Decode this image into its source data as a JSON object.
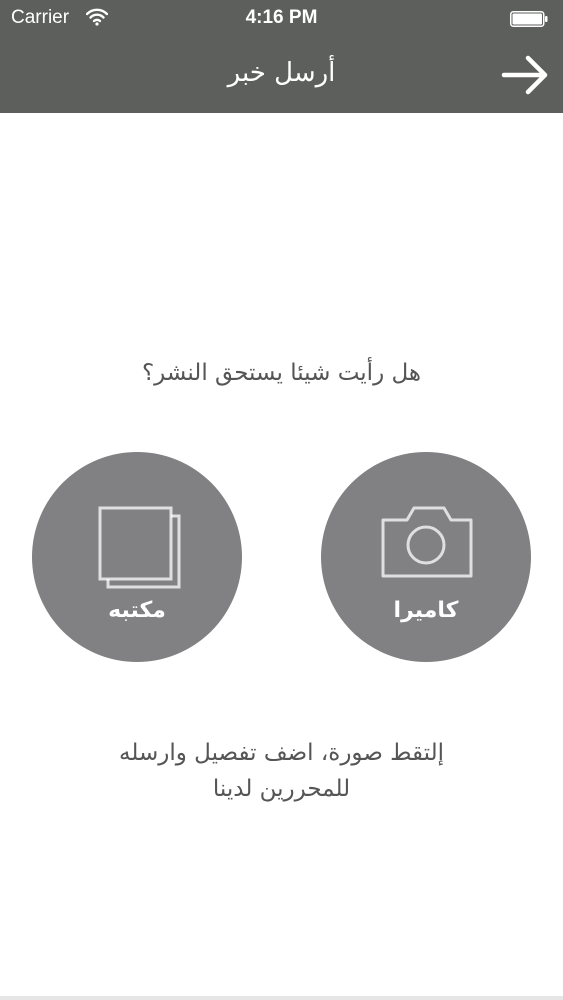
{
  "status_bar": {
    "carrier": "Carrier",
    "time": "4:16 PM",
    "wifi_icon": "wifi-icon",
    "battery_icon": "battery-icon"
  },
  "nav": {
    "title": "أرسل خبر",
    "arrow_icon": "arrow-right-icon"
  },
  "main": {
    "question": "هل رأيت شيئا يستحق النشر؟",
    "library_label": "مكتبه",
    "library_icon": "photo-library-icon",
    "camera_label": "كاميرا",
    "camera_icon": "camera-icon",
    "instructions_line1": "إلتقط صورة، اضف تفصيل وارسله",
    "instructions_line2": "للمحررين لدينا"
  },
  "colors": {
    "nav_background": "#5d5f5c",
    "circle_fill": "#818082",
    "text_gray": "#555555"
  }
}
